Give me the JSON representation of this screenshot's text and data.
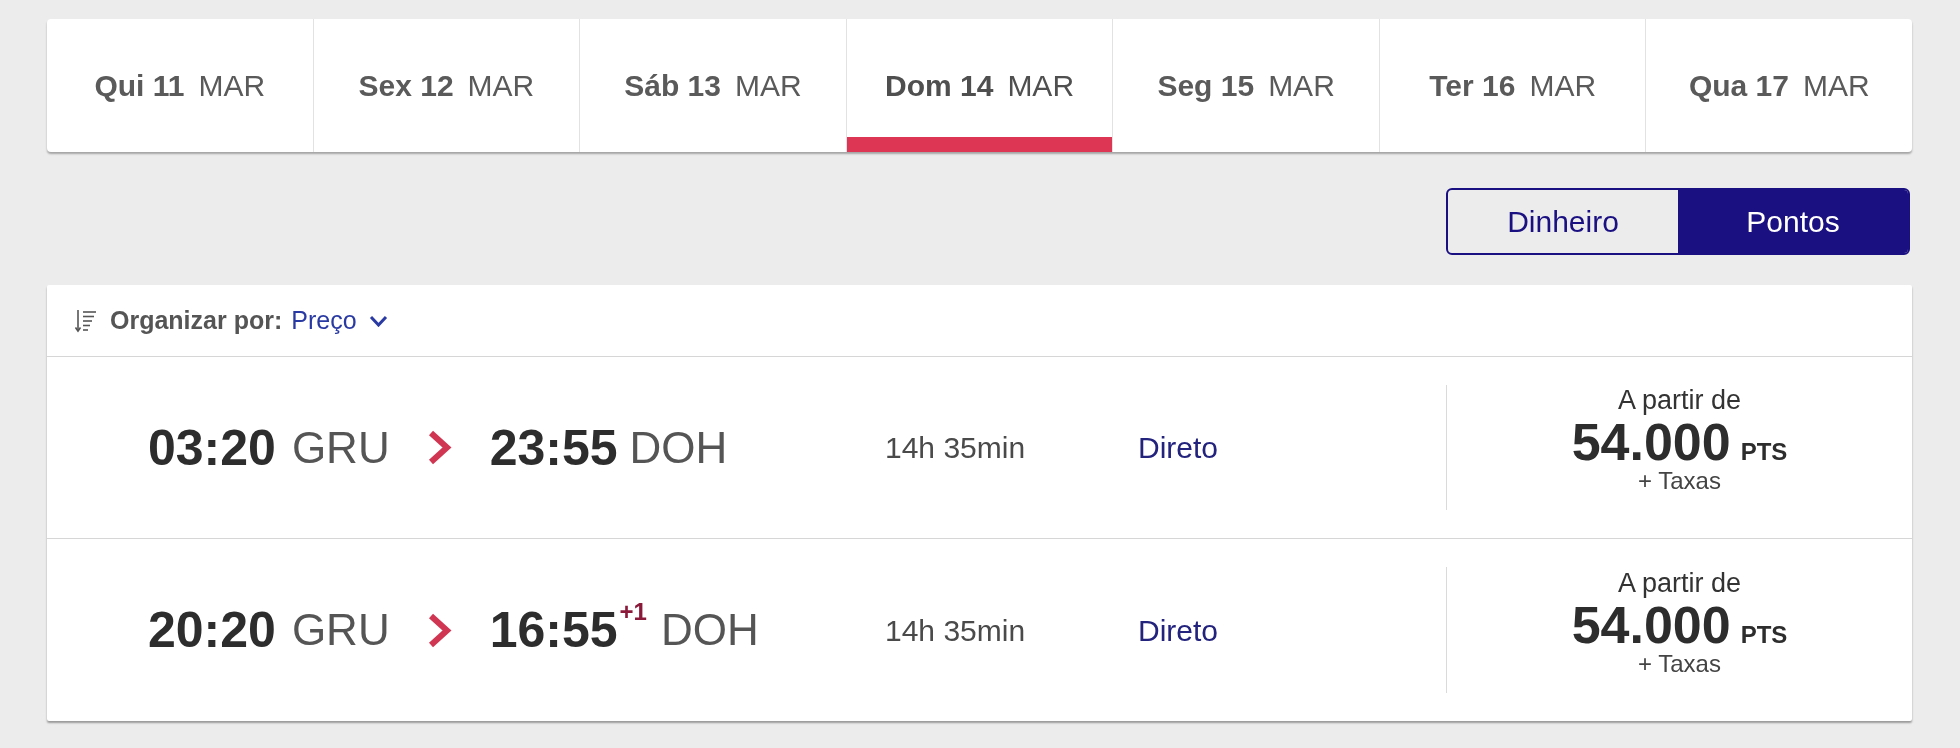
{
  "date_tabs": [
    {
      "day": "Qui 11",
      "month": "MAR",
      "selected": false
    },
    {
      "day": "Sex 12",
      "month": "MAR",
      "selected": false
    },
    {
      "day": "Sáb 13",
      "month": "MAR",
      "selected": false
    },
    {
      "day": "Dom 14",
      "month": "MAR",
      "selected": true
    },
    {
      "day": "Seg 15",
      "month": "MAR",
      "selected": false
    },
    {
      "day": "Ter 16",
      "month": "MAR",
      "selected": false
    },
    {
      "day": "Qua 17",
      "month": "MAR",
      "selected": false
    }
  ],
  "fare_toggle": [
    {
      "label": "Dinheiro",
      "selected": false
    },
    {
      "label": "Pontos",
      "selected": true
    }
  ],
  "sort": {
    "label": "Organizar por:",
    "value": "Preço"
  },
  "flights": [
    {
      "departure_time": "03:20",
      "origin": "GRU",
      "arrival_time": "23:55",
      "destination": "DOH",
      "duration": "14h 35min",
      "stops": "Direto",
      "price_prefix": "A partir de",
      "price": "54.000",
      "price_unit": "PTS",
      "fees": "+ Taxas"
    },
    {
      "departure_time": "20:20",
      "origin": "GRU",
      "arrival_time": "16:55",
      "day_offset": "+1",
      "destination": "DOH",
      "duration": "14h 35min",
      "stops": "Direto",
      "price_prefix": "A partir de",
      "price": "54.000",
      "price_unit": "PTS",
      "fees": "+ Taxas"
    }
  ]
}
